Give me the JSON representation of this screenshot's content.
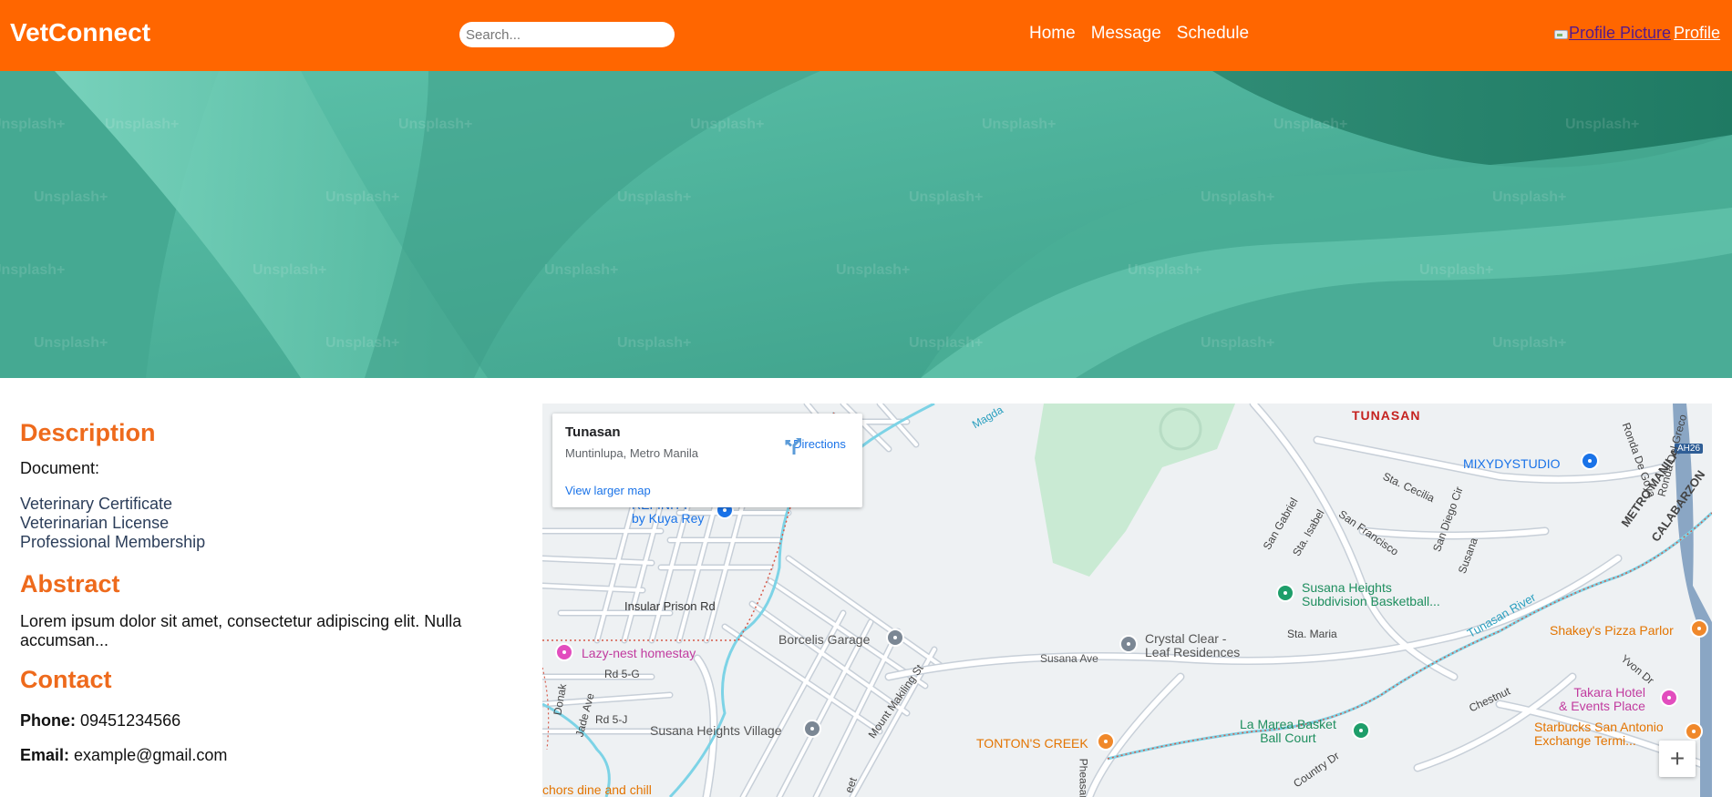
{
  "header": {
    "brand": "VetConnect",
    "search_placeholder": "Search...",
    "nav": {
      "home": "Home",
      "message": "Message",
      "schedule": "Schedule"
    },
    "profile_picture_alt": "Profile Picture",
    "profile_label": "Profile",
    "bg_color": "#ff6600"
  },
  "banner": {
    "watermark": "Unsplash+"
  },
  "description": {
    "title": "Description",
    "document_label": "Document:",
    "documents": [
      "Veterinary Certificate",
      "Veterinarian License",
      "Professional Membership"
    ]
  },
  "abstract": {
    "title": "Abstract",
    "text": "Lorem ipsum dolor sit amet, consectetur adipiscing elit. Nulla accumsan..."
  },
  "contact": {
    "title": "Contact",
    "phone_label": "Phone:",
    "phone": "09451234566",
    "email_label": "Email:",
    "email": "example@gmail.com"
  },
  "map": {
    "card": {
      "place": "Tunasan",
      "address": "Muntinlupa, Metro Manila",
      "directions": "Directions",
      "larger_map": "View larger map"
    },
    "zoom_in": "+",
    "labels": {
      "tunasan": "TUNASAN",
      "mixydystudio": "MIXYDYSTUDIO",
      "refinity_1": "REFINITY",
      "refinity_2": "by Kuya Rey",
      "insular": "Insular Prison Rd",
      "lazy_nest": "Lazy-nest homestay",
      "borcelis": "Borcelis Garage",
      "crystal_1": "Crystal Clear -",
      "crystal_2": "Leaf Residences",
      "susana_ave": "Susana Ave",
      "susana_heights_1": "Susana Heights",
      "susana_heights_2": "Subdivision Basketball...",
      "susana_village": "Susana Heights Village",
      "tontons": "TONTON'S CREEK",
      "la_marea_1": "La Marea Basket",
      "la_marea_2": "Ball Court",
      "shakeys": "Shakey's Pizza Parlor",
      "takara_1": "Takara Hotel",
      "takara_2": "& Events Place",
      "starbucks_1": "Starbucks San Antonio",
      "starbucks_2": "Exchange Termi...",
      "anchors": "chors dine and chill",
      "tunasan_river": "Tunasan River",
      "metro_manila": "METRO MANILA",
      "calabarzon": "CALABARZON",
      "ah26": "AH26",
      "magdaong": "Magda",
      "rd5g": "Rd 5-G",
      "rd5j": "Rd 5-J",
      "jade": "Jade Ave",
      "donak": "Donak",
      "mount_makiling": "Mount Makiling St",
      "sta_maria": "Sta. Maria",
      "san_gabriel": "San Gabriel",
      "sta_isabel": "Sta. Isabel",
      "san_francisco": "San Francisco",
      "sta_cecilia": "Sta. Cecilia",
      "san_diego": "San Diego Cir",
      "susana_st": "Susana",
      "ronda": "Ronda De Goya",
      "ronda_greco": "Ronda Del Greco",
      "yvon": "Yvon Dr",
      "chestnut": "Chestnut",
      "country": "Country Dr",
      "pheasant": "Pheasant",
      "street": "eet"
    },
    "colors": {
      "water": "#7dd3e6",
      "park": "#c9ead3",
      "road": "#ffffff",
      "road_outline": "#c7cfd8"
    }
  }
}
